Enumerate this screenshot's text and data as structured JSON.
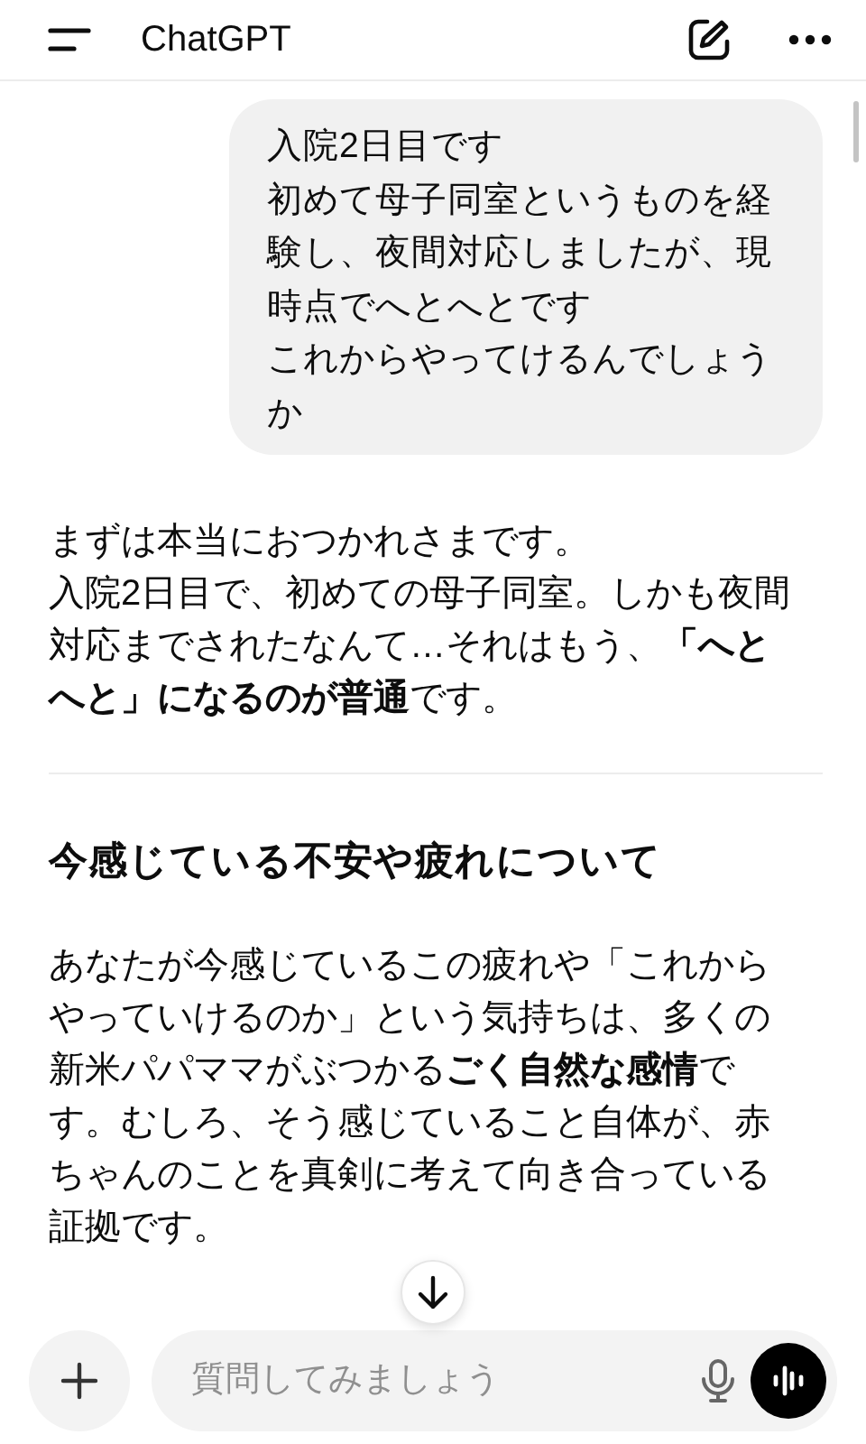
{
  "header": {
    "title": "ChatGPT"
  },
  "user_message": {
    "lines": [
      "入院2日目です",
      "初めて母子同室というものを経験し、夜間対応しましたが、現時点でへとへとです",
      "これからやってけるんでしょうか"
    ]
  },
  "reply": [
    {
      "kind": "paragraph",
      "lines": [
        "まずは本当におつかれさまです。",
        "入院2日目で、初めての母子同室。しかも夜間対応までされたなんて…それはもう、**「へとへと」になるのが普通**です。"
      ]
    },
    {
      "kind": "divider"
    },
    {
      "kind": "heading",
      "text": "今感じている不安や疲れについて"
    },
    {
      "kind": "paragraph",
      "lines": [
        "あなたが今感じているこの疲れや「これからやっていけるのか」という気持ちは、多くの新米パパママがぶつかる**ごく自然な感情**です。むしろ、そう感じていること自体が、赤ちゃんのことを真剣に考えて向き合っている証拠です。"
      ]
    }
  ],
  "composer": {
    "placeholder": "質問してみましょう"
  }
}
